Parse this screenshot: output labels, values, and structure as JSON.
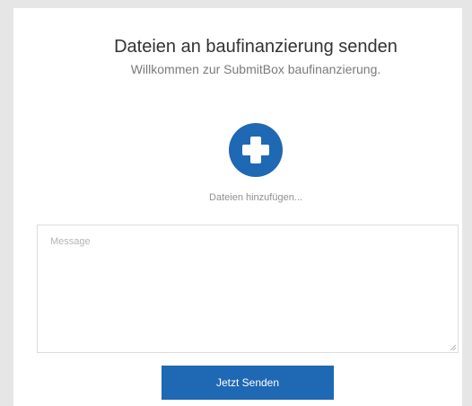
{
  "header": {
    "title": "Dateien an baufinanzierung senden",
    "subtitle": "Willkommen zur SubmitBox baufinanzierung."
  },
  "upload": {
    "icon": "plus-icon",
    "label": "Dateien hinzufügen..."
  },
  "message": {
    "placeholder": "Message",
    "value": ""
  },
  "submit": {
    "label": "Jetzt Senden"
  },
  "colors": {
    "accent": "#1f68b3",
    "background": "#e6e6e6",
    "card": "#ffffff"
  }
}
